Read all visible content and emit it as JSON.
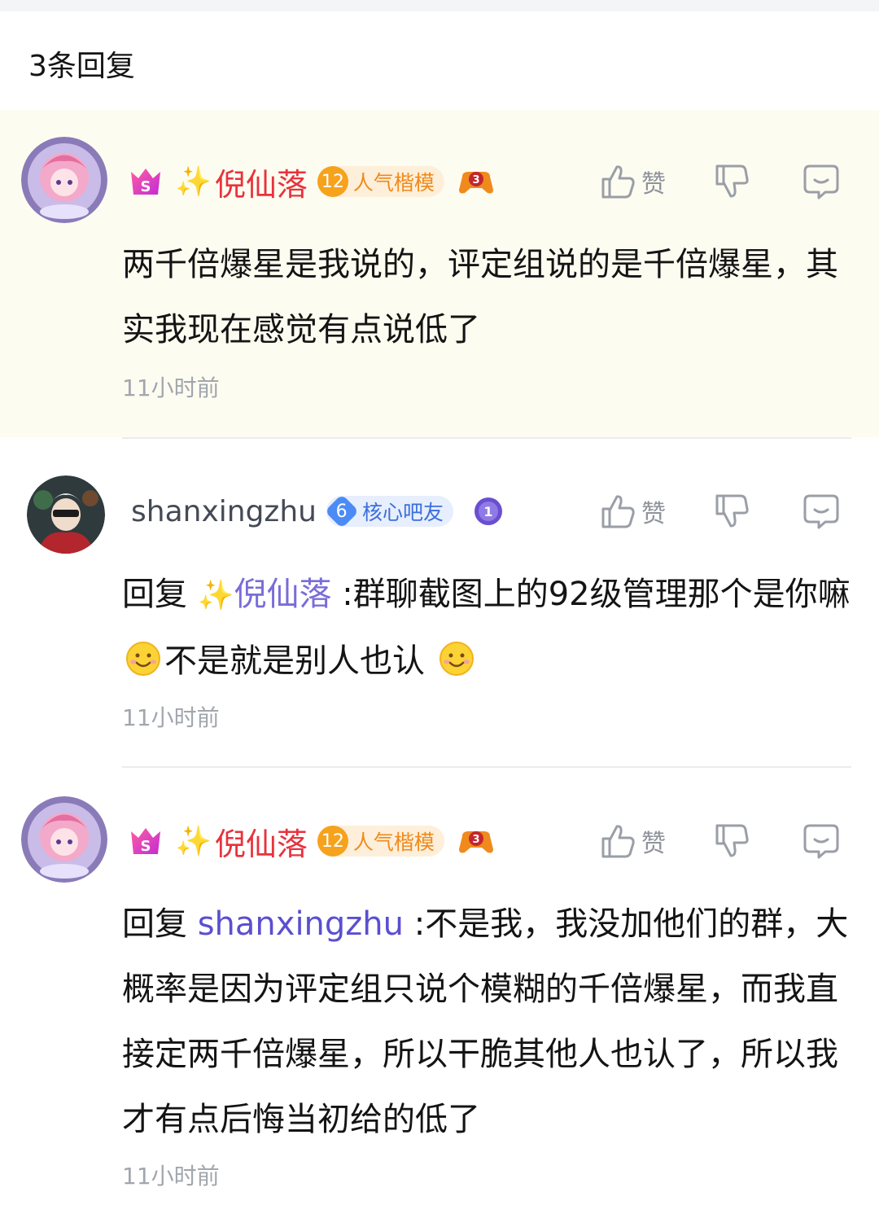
{
  "header": {
    "reply_count": "3条回复"
  },
  "comments": [
    {
      "username_sparkle": "✨",
      "username": "倪仙落",
      "level": "12",
      "level_title": "人气楷模",
      "like_label": "赞",
      "content": "两千倍爆星是我说的，评定组说的是千倍爆星，其实我现在感觉有点说低了",
      "time": "11小时前"
    },
    {
      "username": "shanxingzhu",
      "level": "6",
      "level_title": "核心吧友",
      "like_label": "赞",
      "reply_prefix": "回复",
      "mention_sparkle": "✨",
      "mention": "倪仙落",
      "content_a": " :群聊截图上的92级管理那个是你嘛",
      "content_b": "不是就是别人也认",
      "time": "11小时前"
    },
    {
      "username_sparkle": "✨",
      "username": "倪仙落",
      "level": "12",
      "level_title": "人气楷模",
      "like_label": "赞",
      "reply_prefix": "回复",
      "mention": "shanxingzhu",
      "content": " :不是我，我没加他们的群，大概率是因为评定组只说个模糊的千倍爆星，而我直接定两千倍爆星，所以干脆其他人也认了，所以我才有点后悔当初给的低了",
      "time": "11小时前"
    }
  ]
}
